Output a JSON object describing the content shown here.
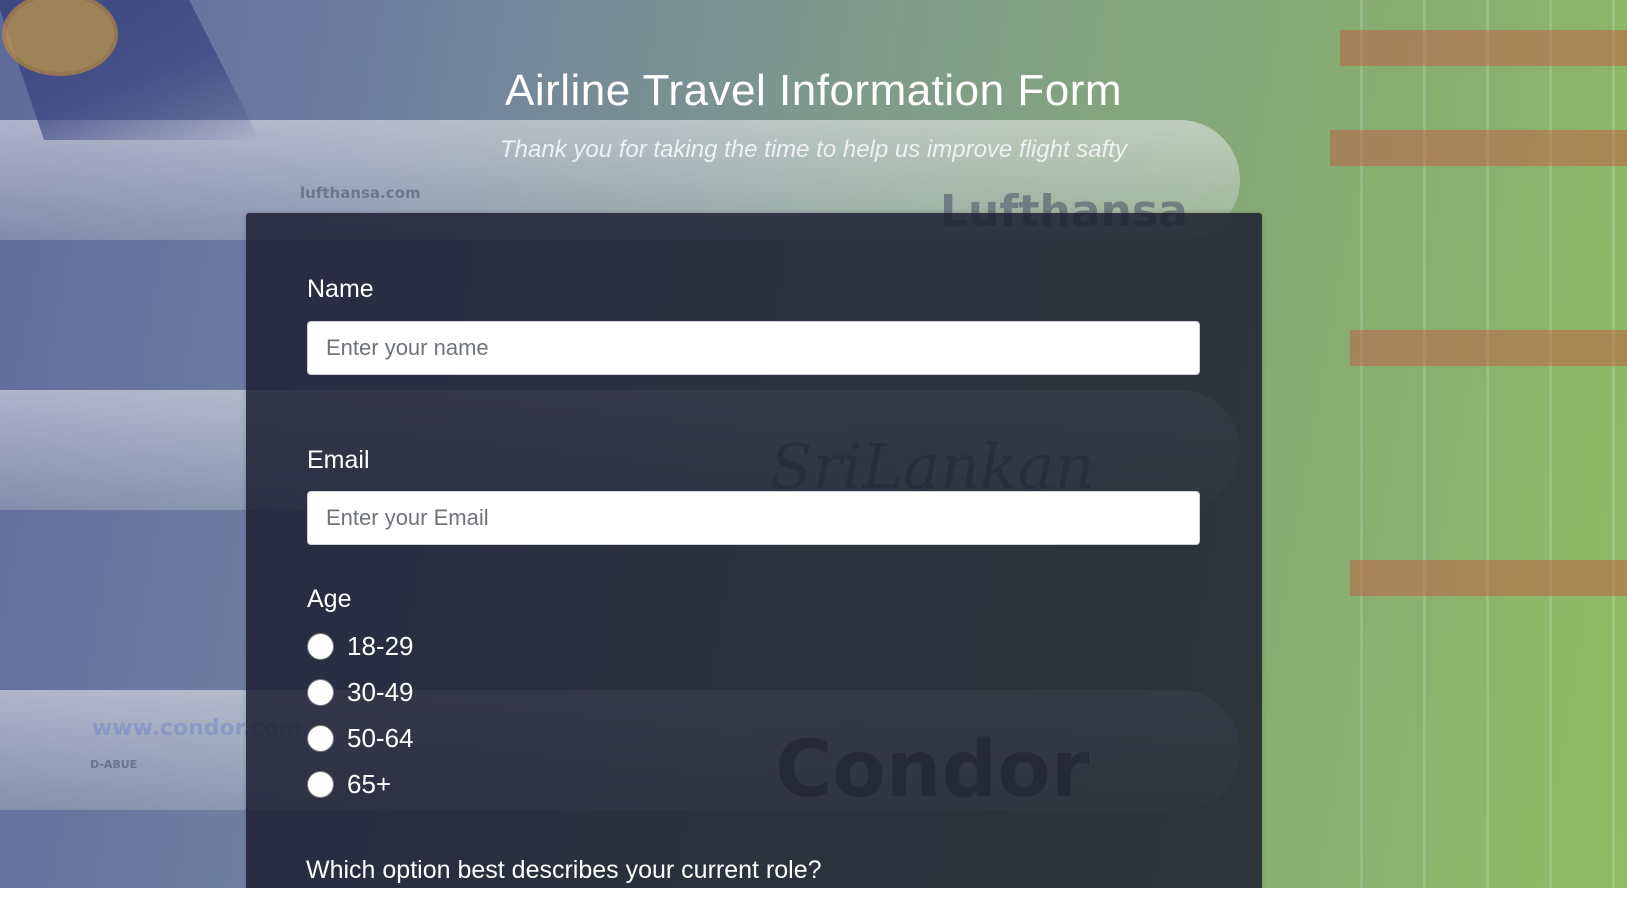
{
  "header": {
    "title": "Airline Travel Information Form",
    "subtitle": "Thank you for taking the time to help us improve flight safty"
  },
  "background": {
    "texts": [
      "lufthansa.com",
      "Lufthansa",
      "SriLankan",
      "www.condor.com",
      "Condor",
      "D-ABUE"
    ]
  },
  "form": {
    "name": {
      "label": "Name",
      "placeholder": "Enter your name",
      "value": ""
    },
    "email": {
      "label": "Email",
      "placeholder": "Enter your Email",
      "value": ""
    },
    "age": {
      "label": "Age",
      "options": [
        "18-29",
        "30-49",
        "50-64",
        "65+"
      ],
      "selected": null
    },
    "role_question": "Which option best describes your current role?"
  },
  "colors": {
    "card": "#1b1d30",
    "text": "#ffffff",
    "input_bg": "#ffffff"
  }
}
